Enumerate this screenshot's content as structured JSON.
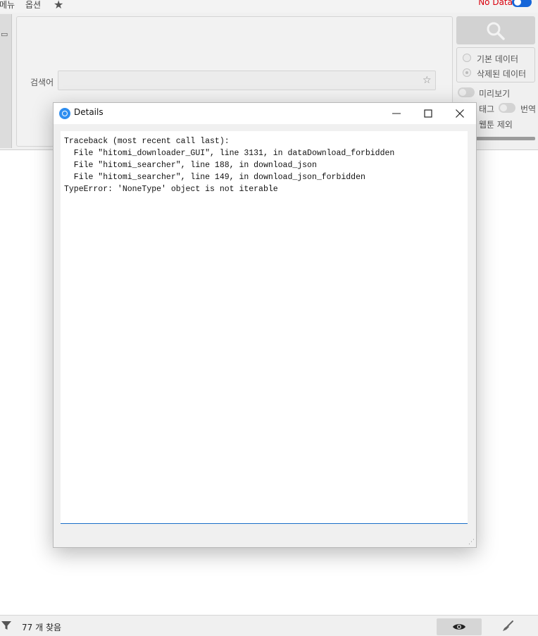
{
  "menubar": {
    "menu_label": "메뉴",
    "options_label": "옵션",
    "status_text": "No Data"
  },
  "search": {
    "label": "검색어",
    "value": "",
    "placeholder": ""
  },
  "right_panel": {
    "radio_basic_label": "기본 데이터",
    "radio_deleted_label": "삭제된 데이터",
    "preview_label": "미리보기",
    "tag_label": "태그",
    "translate_label": "번역",
    "exclude_webtoon_label": "웹툰 제외"
  },
  "dialog": {
    "title": "Details",
    "details_text": "Traceback (most recent call last):\n  File \"hitomi_downloader_GUI\", line 3131, in dataDownload_forbidden\n  File \"hitomi_searcher\", line 188, in download_json\n  File \"hitomi_searcher\", line 149, in download_json_forbidden\nTypeError: 'NoneType' object is not iterable"
  },
  "statusbar": {
    "count_text": "77 개 찾음"
  },
  "icons": {
    "favorite": "star-icon",
    "search": "magnifier-icon",
    "app": "app-logo-icon",
    "minimize": "minimize-icon",
    "maximize": "maximize-icon",
    "close": "close-icon",
    "filter": "filter-icon",
    "preview": "eye-icon",
    "clear": "brush-icon"
  },
  "colors": {
    "accent": "#1565d8",
    "status_error": "#d9000d",
    "focus_border": "#1a6fc9"
  }
}
